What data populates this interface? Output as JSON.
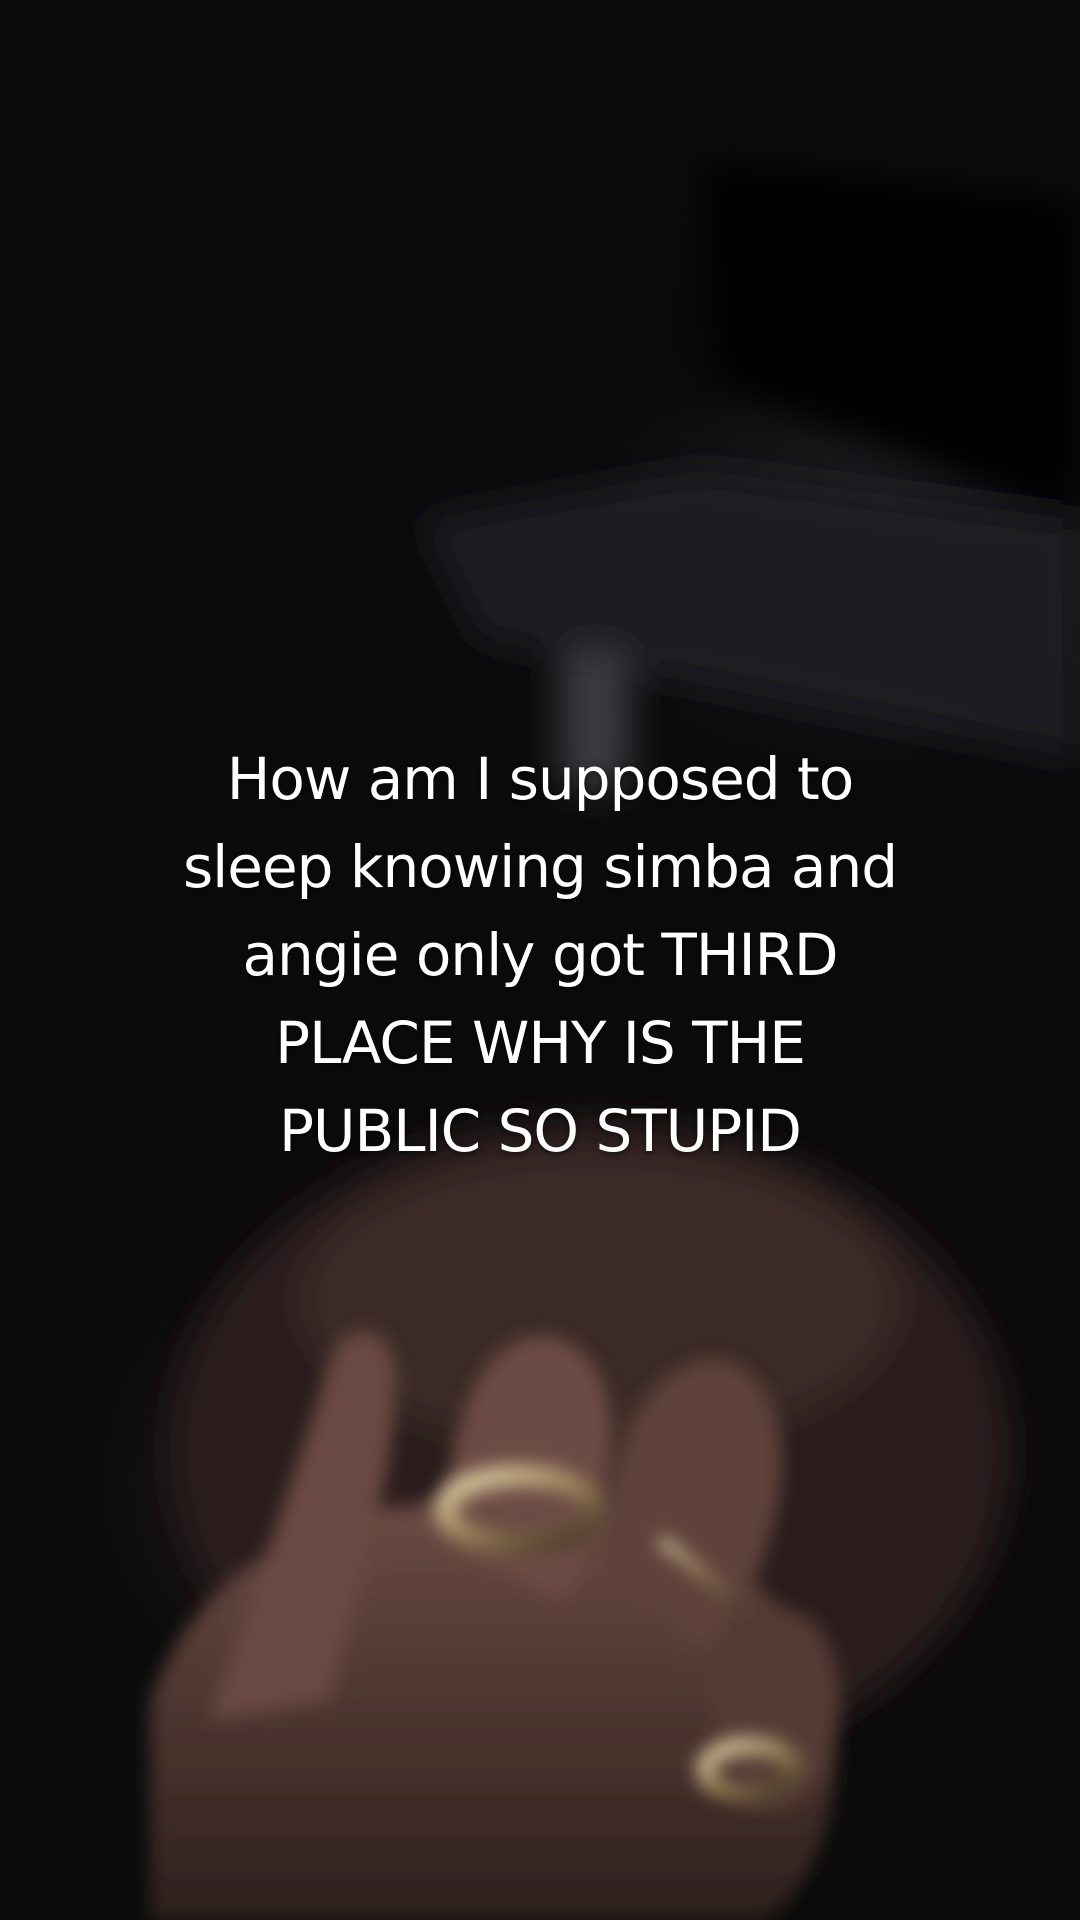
{
  "caption": {
    "text": "How am I supposed to\nsleep knowing simba and\nangie only got THIRD\nPLACE WHY IS THE\nPUBLIC SO STUPID"
  },
  "colors": {
    "background": "#0b0b0c",
    "caption_text": "#ffffff",
    "skin_tone": "#5a3f38",
    "ring_gold": "#b8a072"
  },
  "scene": {
    "description_icon": "hand-with-rings"
  }
}
